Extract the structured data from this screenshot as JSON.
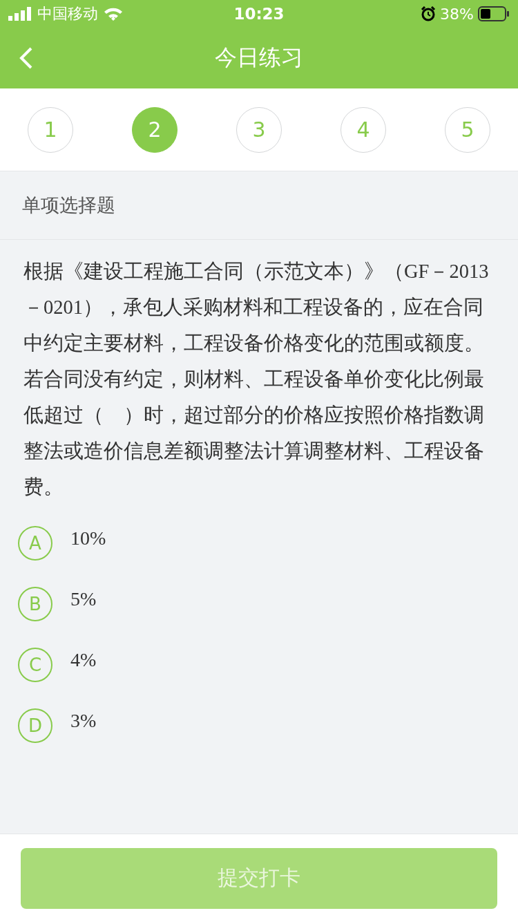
{
  "status_bar": {
    "carrier": "中国移动",
    "time": "10:23",
    "battery": "38%"
  },
  "header": {
    "title": "今日练习"
  },
  "steps": [
    {
      "label": "1",
      "selected": false
    },
    {
      "label": "2",
      "selected": true
    },
    {
      "label": "3",
      "selected": false
    },
    {
      "label": "4",
      "selected": false
    },
    {
      "label": "5",
      "selected": false
    }
  ],
  "question": {
    "type_label": "单项选择题",
    "text": "根据《建设工程施工合同（示范文本）》（GF－2013－0201），承包人采购材料和工程设备的，应在合同中约定主要材料，工程设备价格变化的范围或额度。若合同没有约定，则材料、工程设备单价变化比例最低超过（　）时，超过部分的价格应按照价格指数调整法或造价信息差额调整法计算调整材料、工程设备费。",
    "options": [
      {
        "letter": "A",
        "text": "10%",
        "selected": false
      },
      {
        "letter": "B",
        "text": "5%",
        "selected": false
      },
      {
        "letter": "C",
        "text": "4%",
        "selected": false
      },
      {
        "letter": "D",
        "text": "3%",
        "selected": false
      }
    ]
  },
  "submit_button": {
    "label": "提交打卡",
    "disabled": true
  }
}
